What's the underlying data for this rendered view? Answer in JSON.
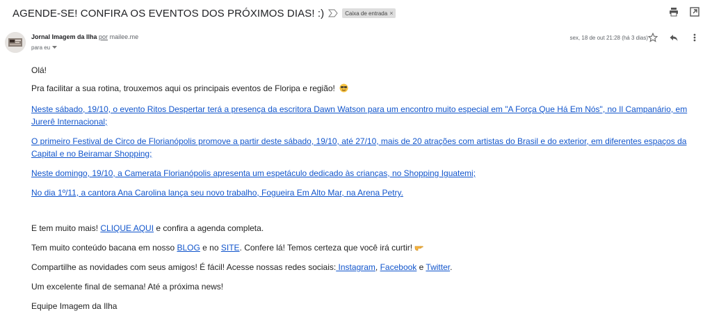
{
  "subject": {
    "title": "AGENDE-SE! CONFIRA OS EVENTOS DOS PRÓXIMOS DIAS! :)",
    "label": "Caixa de entrada",
    "label_close": "×"
  },
  "sender": {
    "name": "Jornal Imagem da Ilha",
    "via": "por",
    "domain": "mailee.me",
    "to": "para eu",
    "date": "sex, 18 de out 21:28 (há 3 dias)"
  },
  "body": {
    "greeting": "Olá!",
    "intro": "Pra facilitar a sua rotina, trouxemos aqui os principais eventos de Floripa e região!",
    "links": [
      "Neste sábado, 19/10, o evento Ritos Despertar terá a presença da escritora Dawn Watson para um encontro muito especial em \"A Força Que Há Em Nós\", no Il Campanário, em Jurerê Internacional;",
      "O primeiro Festival de Circo de Florianópolis promove a partir deste sábado, 19/10, até 27/10, mais de 20 atrações com artistas do Brasil e do exterior, em diferentes espaços da Capital e no Beiramar Shopping;",
      "Neste domingo, 19/10, a Camerata Florianópolis apresenta um espetáculo dedicado às crianças, no Shopping Iguatemi;",
      "No dia 1º/11, a cantora Ana Carolina lança seu novo trabalho, Fogueira Em Alto Mar, na Arena Petry."
    ],
    "more_prefix": "E tem muito mais! ",
    "more_link": "CLIQUE AQUI",
    "more_suffix": " e confira a agenda completa.",
    "content_prefix": "Tem muito conteúdo bacana em nosso ",
    "blog_link": "BLOG",
    "content_mid": " e no ",
    "site_link": "SITE",
    "content_suffix": ". Confere lá! Temos certeza que você irá curtir!",
    "share_prefix": "Compartilhe as novidades com seus amigos! É fácil! Acesse nossas redes sociais:",
    "instagram_link": " Instagram",
    "comma": ", ",
    "facebook_link": "Facebook",
    "and": " e ",
    "twitter_link": "Twitter",
    "period": ".",
    "weekend": "Um excelente final de semana! Até a próxima news!",
    "signature": "Equipe Imagem da Ilha"
  },
  "icons": {
    "important": "important-marker-icon",
    "print": "print-icon",
    "newwindow": "open-in-new-window-icon",
    "star": "star-icon",
    "reply": "reply-icon",
    "more": "more-vertical-icon",
    "sunglasses": "sunglasses-emoji-icon",
    "pointing": "pointing-hand-emoji-icon"
  }
}
